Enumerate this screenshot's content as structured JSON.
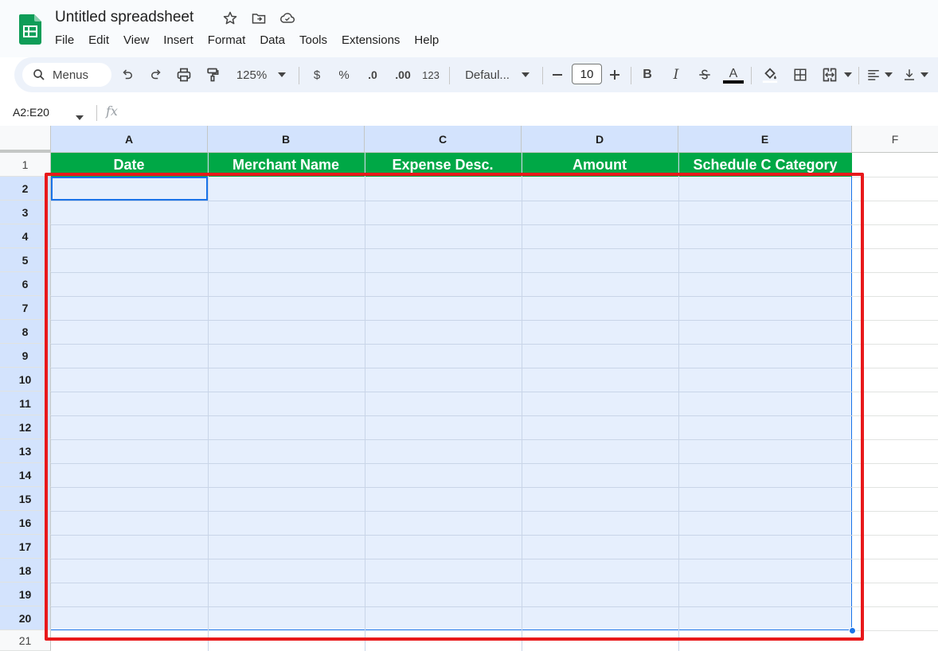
{
  "app": {
    "title": "Untitled spreadsheet",
    "menu": [
      "File",
      "Edit",
      "View",
      "Insert",
      "Format",
      "Data",
      "Tools",
      "Extensions",
      "Help"
    ]
  },
  "toolbar": {
    "search_label": "Menus",
    "zoom": "125%",
    "currency": "$",
    "percent": "%",
    "decrease_decimal": ".0",
    "increase_decimal": ".00",
    "number_format": "123",
    "font": "Defaul...",
    "font_size": "10",
    "bold": "B",
    "italic": "I",
    "text_color": "A"
  },
  "formula_bar": {
    "name_box": "A2:E20",
    "fx": "fx"
  },
  "columns": [
    "A",
    "B",
    "C",
    "D",
    "E",
    "F"
  ],
  "header_row": [
    "Date",
    "Merchant Name",
    "Expense Desc.",
    "Amount",
    "Schedule C Category"
  ],
  "rows": [
    "1",
    "2",
    "3",
    "4",
    "5",
    "6",
    "7",
    "8",
    "9",
    "10",
    "11",
    "12",
    "13",
    "14",
    "15",
    "16",
    "17",
    "18",
    "19",
    "20",
    "21"
  ],
  "colors": {
    "header_fill": "#00a846",
    "selection": "#e6effd",
    "annotation": "#e8191b"
  }
}
